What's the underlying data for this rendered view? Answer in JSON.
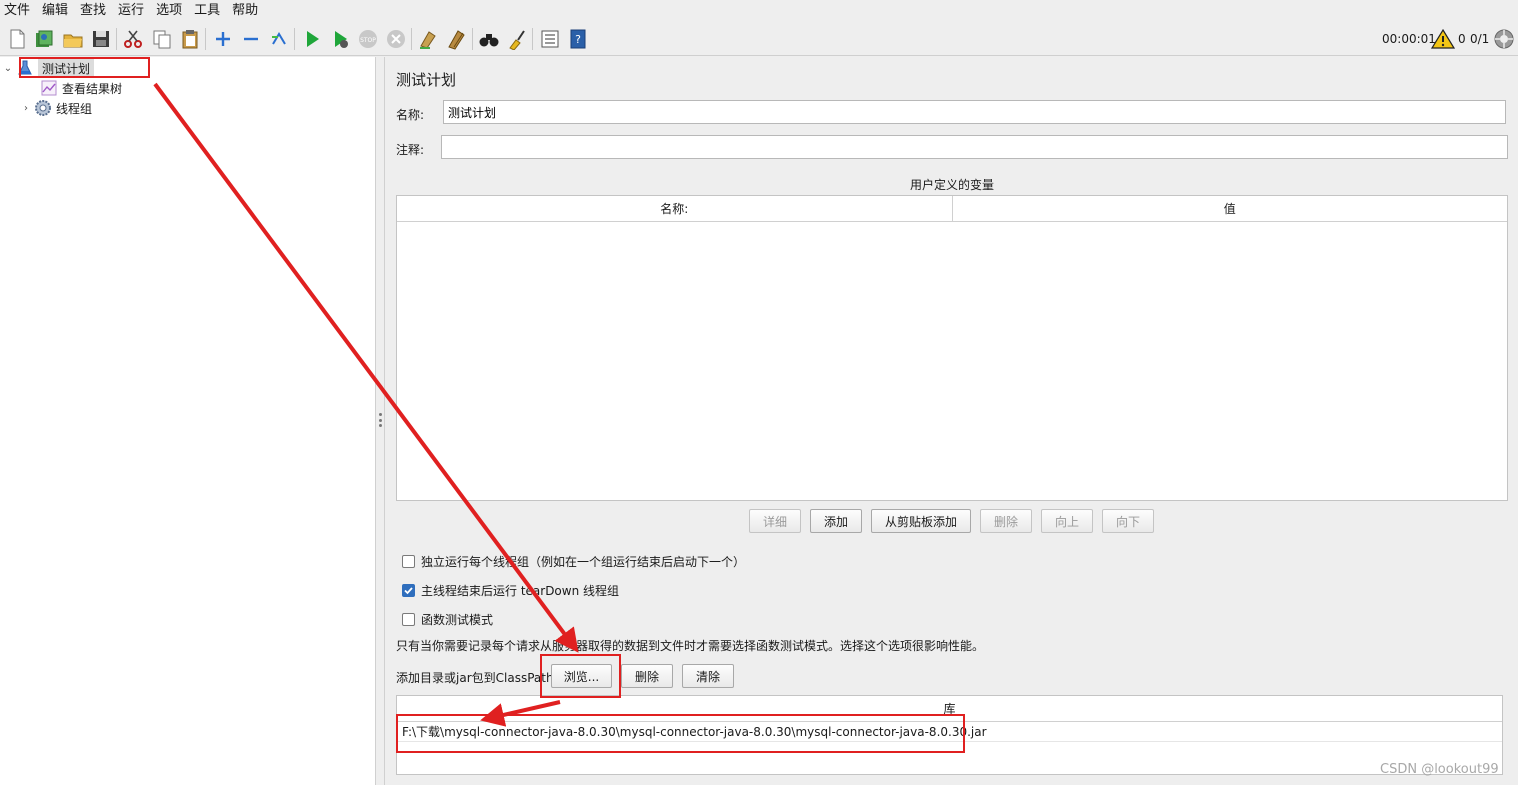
{
  "menu": [
    "文件",
    "编辑",
    "查找",
    "运行",
    "选项",
    "工具",
    "帮助"
  ],
  "toolbar": {
    "timer": "00:00:01",
    "warning_count": "0",
    "thread_count": "0/1",
    "icons": [
      "new-icon",
      "templates-icon",
      "open-icon",
      "save-icon",
      "cut-icon",
      "copy-icon",
      "paste-icon",
      "expand-icon",
      "collapse-icon",
      "toggle-icon",
      "start-icon",
      "start-no-pause-icon",
      "stop-icon",
      "shutdown-icon",
      "clear-icon",
      "clear-all-icon",
      "search-icon",
      "reset-search-icon",
      "function-helper-icon",
      "help-icon"
    ]
  },
  "tree": {
    "plan": "测试计划",
    "results": "查看结果树",
    "thread_group": "线程组"
  },
  "main": {
    "title": "测试计划",
    "name_label": "名称:",
    "name_value": "测试计划",
    "comment_label": "注释:",
    "comment_value": "",
    "vars_title": "用户定义的变量",
    "vars_columns": [
      "名称:",
      "值"
    ],
    "buttons": {
      "detail": "详细",
      "add": "添加",
      "add_clipboard": "从剪贴板添加",
      "delete": "删除",
      "up": "向上",
      "down": "向下"
    },
    "checkboxes": [
      {
        "label": "独立运行每个线程组（例如在一个组运行结束后启动下一个）",
        "checked": false
      },
      {
        "label": "主线程结束后运行 tearDown 线程组",
        "checked": true
      },
      {
        "label": "函数测试模式",
        "checked": false
      }
    ],
    "note": "只有当你需要记录每个请求从服务器取得的数据到文件时才需要选择函数测试模式。选择这个选项很影响性能。",
    "classpath_label": "添加目录或jar包到ClassPath",
    "classpath_buttons": {
      "browse": "浏览...",
      "delete": "删除",
      "clear": "清除"
    },
    "lib_header": "库",
    "lib_rows": [
      "F:\\下载\\mysql-connector-java-8.0.30\\mysql-connector-java-8.0.30\\mysql-connector-java-8.0.30.jar"
    ]
  },
  "watermark": "CSDN @lookout99",
  "colors": {
    "annotation": "#e02020",
    "checkbox": "#2f6ebd",
    "background": "#eeeeee"
  }
}
